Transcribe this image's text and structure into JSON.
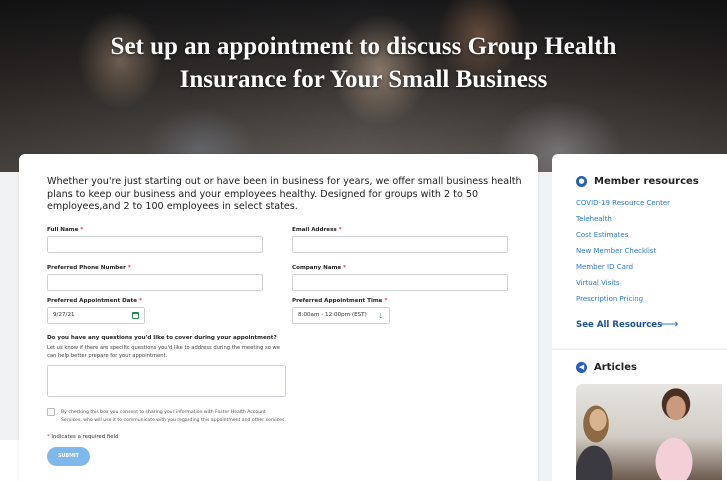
{
  "hero": {
    "title": "Set up an appointment to discuss Group Health Insurance for Your Small Business"
  },
  "form": {
    "intro": "Whether you're just starting out or have been in business for years, we offer small business health plans to keep our business and your employees healthy. Designed for groups with 2 to 50 employees,and 2 to 100 employees in select states.",
    "full_name_label": "Full Name",
    "email_label": "Email Address",
    "phone_label": "Preferred Phone Number",
    "company_label": "Company Name",
    "date_label": "Preferred Appointment Date",
    "date_value": "9/27/21",
    "time_label": "Preferred Appointment Time",
    "time_value": "8:00am - 12:00pm (EST)",
    "required_mark": "*",
    "questions_label": "Do you have any questions you'd like to cover during your appointment?",
    "questions_sub": "Let us know if there are specific questions you'd like to address during the meeting so we can help better prepare for your appointment.",
    "consent_text": "By checking this box you consent to sharing your information with Foster Health Account Services, who will use it to communicate with you regarding this appointment and other services.",
    "required_note": "Indicates a required field",
    "submit_label": "SUBMIT"
  },
  "sidebar": {
    "member_resources_title": "Member resources",
    "links": [
      "COVID-19 Resource Center",
      "Telehealth",
      "Cost Estimates",
      "New Member Checklist",
      "Member ID Card",
      "Virtual Visits",
      "Prescription Pricing"
    ],
    "see_all_label": "See All Resources",
    "articles_title": "Articles"
  },
  "colors": {
    "accent": "#2a7bd6",
    "see_all": "#1d4f9c",
    "submit": "#7fb8ea",
    "required": "#dd3333",
    "input_icon": "#1f8a4c"
  },
  "icons": {
    "member_resources": "person-circle-icon",
    "articles": "megaphone-icon",
    "date": "calendar-icon",
    "time": "arrow-down-icon",
    "see_all": "arrow-right-icon"
  }
}
